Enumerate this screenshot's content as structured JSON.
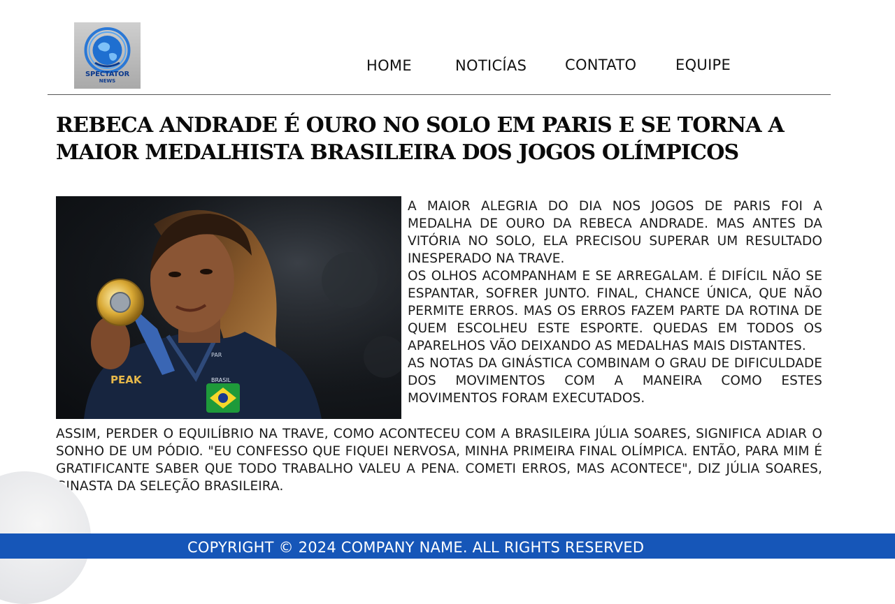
{
  "brand": {
    "logo_line1": "SPECTATOR",
    "logo_line2": "NEWS"
  },
  "nav": {
    "home": "HOME",
    "news": "NOTICÍAS",
    "contact": "CONTATO",
    "team": "EQUIPE"
  },
  "article": {
    "title": "REBECA ANDRADE É OURO NO SOLO EM PARIS E SE TORNA A MAIOR MEDALHISTA BRASILEIRA DOS JOGOS OLÍMPICOS",
    "paragraph1": "A maior alegria do dia nos Jogos de Paris foi a medalha de ouro da Rebeca Andrade. Mas antes da vitória no solo, ela precisou superar um resultado inesperado na trave.",
    "paragraph2": "Os olhos acompanham e se arregalam. É difícil não se espantar, sofrer junto. Final, chance única, que não permite erros. Mas os erros fazem parte da rotina de quem escolheu este esporte. Quedas em todos os aparelhos vão deixando as medalhas mais distantes.",
    "paragraph3": "As notas da ginástica combinam o grau de dificuldade dos movimentos com a maneira como estes movimentos foram executados.",
    "paragraph4": "Assim, perder o equilíbrio na trave, como aconteceu com a brasileira Júlia Soares, significa adiar o sonho de um pódio. \"Eu confesso que fiquei nervosa, minha primeira final olímpica. Então, para mim é gratificante saber que todo trabalho valeu a pena. Cometi erros, mas acontece\", diz Júlia Soares, ginasta da seleção brasileira."
  },
  "photo": {
    "jacket_text": "BRASIL",
    "sponsor_text": "PEAK",
    "sleeve_text": "PAR"
  },
  "footer": {
    "copyright": "COPYRIGHT © 2024 COMPANY NAME. ALL RIGHTS RESERVED"
  },
  "colors": {
    "footer_bg": "#1656b8",
    "logo_blue": "#0d3a8c",
    "text": "#111111"
  },
  "icons": [
    "globe-logo-icon"
  ]
}
